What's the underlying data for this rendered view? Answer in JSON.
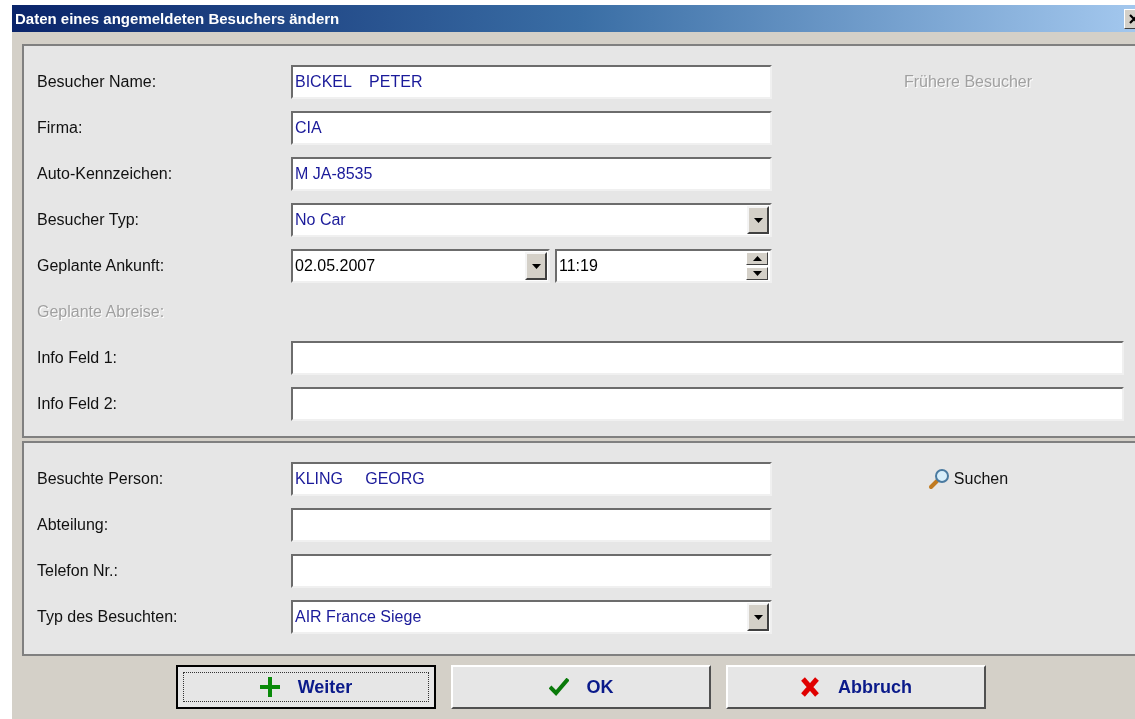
{
  "window": {
    "title": "Daten eines angemeldeten Besuchers ändern"
  },
  "visitor_section": {
    "fields": [
      {
        "label": "Besucher Name:",
        "kind": "text",
        "value": "BICKEL    PETER",
        "disabled": false
      },
      {
        "label": "Firma:",
        "kind": "text",
        "value": "CIA",
        "disabled": false
      },
      {
        "label": "Auto-Kennzeichen:",
        "kind": "text",
        "value": "M JA-8535",
        "disabled": false
      },
      {
        "label": "Besucher Typ:",
        "kind": "select",
        "value": "No Car",
        "disabled": false
      },
      {
        "label": "Geplante Ankunft:",
        "kind": "datetime",
        "date": "02.05.2007",
        "time": "11:19",
        "disabled": false
      },
      {
        "label": "Geplante Abreise:",
        "kind": "none",
        "disabled": true
      },
      {
        "label": "Info Feld 1:",
        "kind": "wide",
        "disabled": false
      },
      {
        "label": "Info Feld 2:",
        "kind": "wide",
        "disabled": false
      }
    ],
    "previous_visitors": {
      "label": "Frühere Besucher",
      "disabled": true
    }
  },
  "visited_section": {
    "fields": [
      {
        "label": "Besuchte Person:",
        "kind": "text",
        "value": "KLING     GEORG",
        "disabled": false
      },
      {
        "label": "Abteilung:",
        "kind": "text",
        "disabled": false
      },
      {
        "label": "Telefon Nr.:",
        "kind": "text",
        "disabled": false
      },
      {
        "label": "Typ des Besuchten:",
        "kind": "select",
        "value": "AIR France Siege",
        "disabled": false
      }
    ],
    "search": {
      "label": "Suchen"
    }
  },
  "buttons": [
    {
      "label": "Weiter",
      "kind": "add",
      "focused": true
    },
    {
      "label": "OK",
      "kind": "ok",
      "focused": false
    },
    {
      "label": "Abbruch",
      "kind": "cancel",
      "focused": false
    }
  ]
}
